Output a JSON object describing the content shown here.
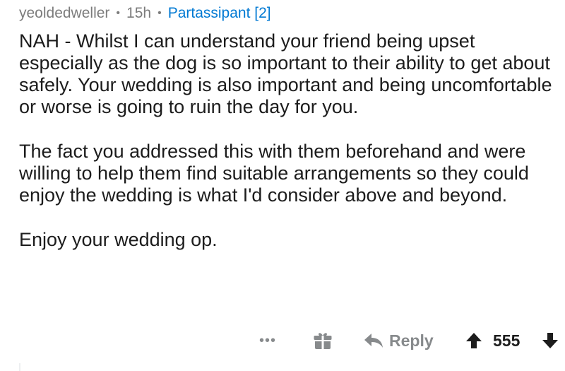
{
  "comment": {
    "author": "yeoldedweller",
    "separator": "•",
    "age": "15h",
    "flair": "Partassipant [2]",
    "paragraphs": [
      "NAH - Whilst I can understand your friend being upset especially as the dog is so important to their ability to get about safely. Your wedding is also important and being uncomfortable or worse is going to ruin the day for you.",
      "The fact you addressed this with them beforehand and were willing to help them find suitable arrangements so they could enjoy the wedding is what I'd consider above and beyond.",
      "Enjoy your wedding op."
    ]
  },
  "actions": {
    "more_label": "•••",
    "more_icon": "more-dots-icon",
    "award_icon": "gift-icon",
    "reply_label": "Reply",
    "reply_icon": "reply-arrow-icon",
    "upvote_icon": "arrow-up-icon",
    "score": "555",
    "downvote_icon": "arrow-down-icon"
  },
  "colors": {
    "text": "#1c1c1c",
    "meta": "#7c7c7c",
    "flair": "#0079d3",
    "icon": "#878a8c",
    "upvote": "#1c1c1c"
  }
}
